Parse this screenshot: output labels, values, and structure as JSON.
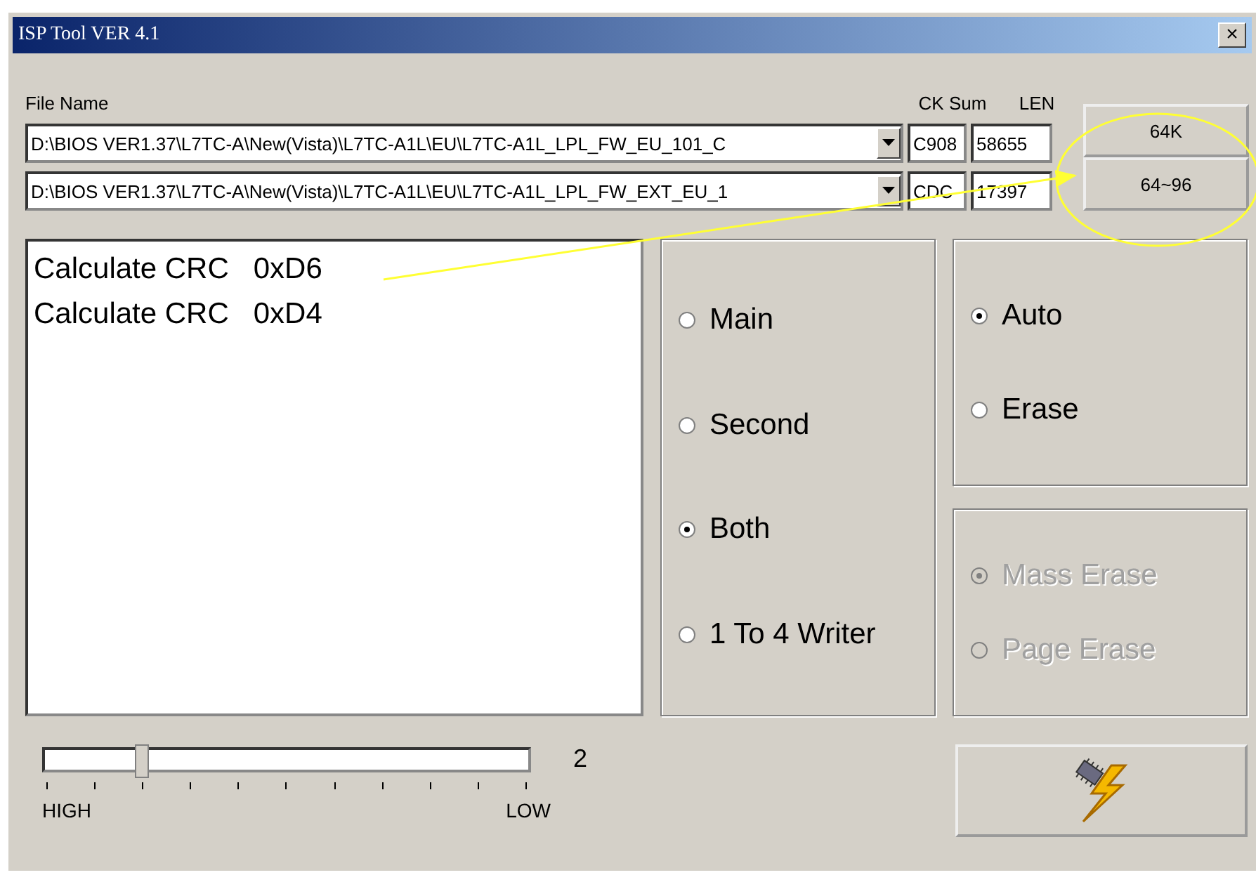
{
  "window": {
    "title": "ISP Tool VER 4.1",
    "close": "×"
  },
  "files": {
    "labels": {
      "file": "File Name",
      "checksum": "CK Sum",
      "length": "LEN"
    },
    "rows": [
      {
        "path": "D:\\BIOS VER1.37\\L7TC-A\\New(Vista)\\L7TC-A1L\\EU\\L7TC-A1L_LPL_FW_EU_101_C",
        "checksum": "C908",
        "length": "58655"
      },
      {
        "path": "D:\\BIOS VER1.37\\L7TC-A\\New(Vista)\\L7TC-A1L\\EU\\L7TC-A1L_LPL_FW_EXT_EU_1",
        "checksum": "CDC",
        "length": "17397"
      }
    ]
  },
  "size_buttons": [
    "64K",
    "64~96"
  ],
  "log": [
    "Calculate CRC   0xD6",
    "Calculate CRC   0xD4"
  ],
  "target_options": [
    {
      "label": "Main",
      "selected": false
    },
    {
      "label": "Second",
      "selected": false
    },
    {
      "label": "Both",
      "selected": true
    },
    {
      "label": "1 To 4 Writer",
      "selected": false
    }
  ],
  "mode_options": [
    {
      "label": "Auto",
      "selected": true
    },
    {
      "label": "Erase",
      "selected": false
    }
  ],
  "erase_options": [
    {
      "label": "Mass Erase",
      "selected": true,
      "disabled": true
    },
    {
      "label": "Page Erase",
      "selected": false,
      "disabled": true
    }
  ],
  "speed": {
    "level": 0.2,
    "reading": "2",
    "min_label": "HIGH",
    "max_label": "LOW"
  },
  "annotation": {
    "kind": "circle-arrow"
  }
}
